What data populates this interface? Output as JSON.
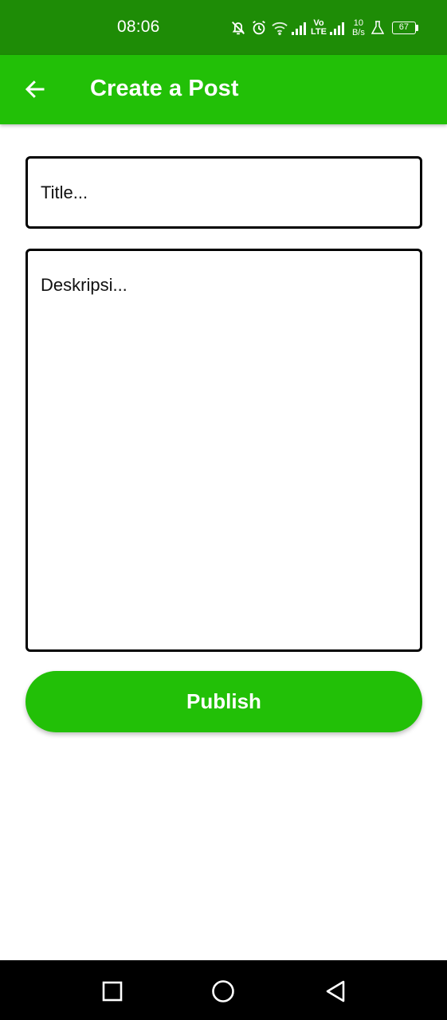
{
  "status_bar": {
    "time": "08:06",
    "volte_top": "Vo",
    "volte_bottom": "LTE",
    "net_speed_value": "10",
    "net_speed_unit": "B/s",
    "battery_level": "67",
    "icons": [
      "bell-off-icon",
      "alarm-icon",
      "wifi-icon",
      "signal-icon",
      "volte-icon",
      "signal-icon",
      "netspeed",
      "lab-icon",
      "battery-icon"
    ]
  },
  "app_bar": {
    "title": "Create a Post",
    "back_icon": "arrow-left-icon"
  },
  "form": {
    "title_placeholder": "Title...",
    "description_placeholder": "Deskripsi...",
    "publish_label": "Publish"
  },
  "nav_bar": {
    "icons": [
      "recent-apps-icon",
      "home-icon",
      "back-icon"
    ]
  },
  "colors": {
    "status_bar": "#1e8c06",
    "app_bar": "#22c007",
    "button": "#22c007",
    "nav_bar": "#000000"
  }
}
